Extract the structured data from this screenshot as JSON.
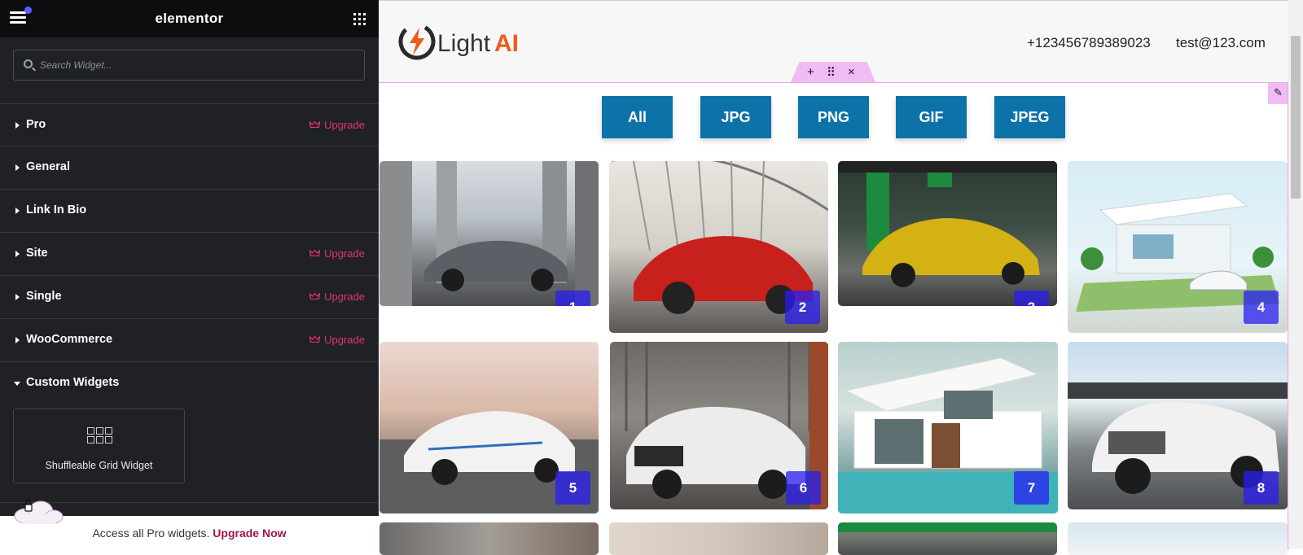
{
  "editor": {
    "brand": "elementor",
    "search_placeholder": "Search Widget...",
    "categories": [
      {
        "label": "Pro",
        "upgrade": "Upgrade"
      },
      {
        "label": "General",
        "upgrade": ""
      },
      {
        "label": "Link In Bio",
        "upgrade": ""
      },
      {
        "label": "Site",
        "upgrade": "Upgrade"
      },
      {
        "label": "Single",
        "upgrade": "Upgrade"
      },
      {
        "label": "WooCommerce",
        "upgrade": "Upgrade"
      },
      {
        "label": "Custom Widgets",
        "upgrade": ""
      }
    ],
    "custom_widget_label": "Shuffleable Grid Widget",
    "promo_text": "Access all Pro widgets.",
    "promo_link": "Upgrade Now",
    "accent_color": "#e0337a"
  },
  "site": {
    "logo_text_light": "Light",
    "logo_text_ai": "AI",
    "phone": "+123456789389023",
    "email": "test@123.com",
    "handle_icons": [
      "+",
      "⠿",
      "×"
    ],
    "filters": [
      "All",
      "JPG",
      "PNG",
      "GIF",
      "JPEG"
    ],
    "filter_color": "#0d72a8",
    "tiles": [
      "1",
      "2",
      "3",
      "4",
      "5",
      "6",
      "7",
      "8"
    ]
  }
}
